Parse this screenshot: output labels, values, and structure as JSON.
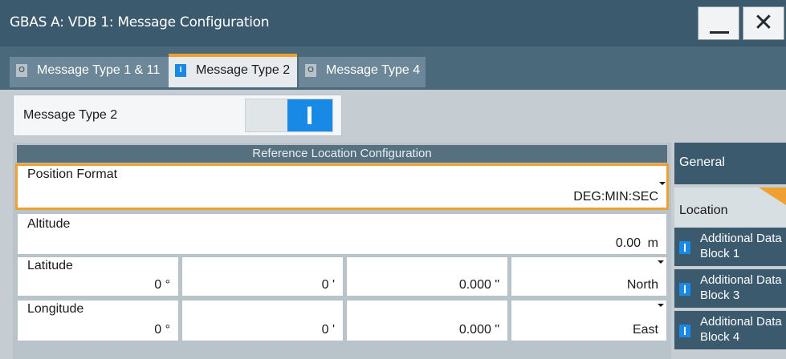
{
  "window": {
    "title": "GBAS A: VDB 1: Message Configuration",
    "minimize_label": "—",
    "close_label": "✕"
  },
  "tabs": [
    {
      "label": "Message Type 1 & 11",
      "state": "O",
      "active": false
    },
    {
      "label": "Message Type 2",
      "state": "I",
      "active": true
    },
    {
      "label": "Message Type 4",
      "state": "O",
      "active": false
    }
  ],
  "message_type_2": {
    "label": "Message Type 2",
    "enabled": true
  },
  "reference_location": {
    "header": "Reference Location Configuration",
    "position_format": {
      "label": "Position Format",
      "value": "DEG:MIN:SEC"
    },
    "altitude": {
      "label": "Altitude",
      "value": "0.00",
      "unit": "m"
    },
    "latitude": {
      "label": "Latitude",
      "deg": "0 °",
      "min": "0 '",
      "sec": "0.000 \"",
      "hemisphere": "North"
    },
    "longitude": {
      "label": "Longitude",
      "deg": "0 °",
      "min": "0 '",
      "sec": "0.000 \"",
      "hemisphere": "East"
    }
  },
  "side_nav": {
    "general": "General",
    "location": "Location",
    "adb1": "Additional Data Block 1",
    "adb3": "Additional Data Block 3",
    "adb4": "Additional Data Block 4"
  },
  "colors": {
    "accent": "#f0a030",
    "on_indicator": "#1989e6",
    "titlebar": "#3c5a6e"
  }
}
